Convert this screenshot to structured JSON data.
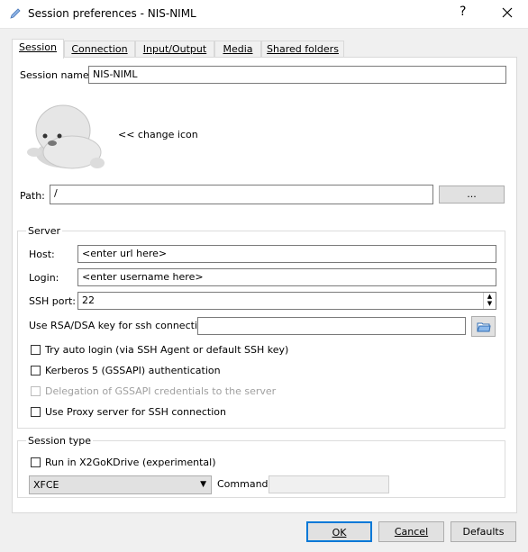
{
  "window": {
    "title": "Session preferences - NIS-NIML",
    "help_label": "?",
    "close_label": "✕"
  },
  "tabs": [
    {
      "label": "Session",
      "active": true
    },
    {
      "label": "Connection",
      "active": false
    },
    {
      "label": "Input/Output",
      "active": false
    },
    {
      "label": "Media",
      "active": false
    },
    {
      "label": "Shared folders",
      "active": false
    }
  ],
  "session": {
    "name_label": "Session name:",
    "name_value": "NIS-NIML",
    "change_icon_label": "<< change icon",
    "path_label": "Path:",
    "path_value": "/",
    "browse_label": "..."
  },
  "server": {
    "title": "Server",
    "host_label": "Host:",
    "host_placeholder": "<enter url here>",
    "login_label": "Login:",
    "login_placeholder": "<enter username here>",
    "ssh_port_label": "SSH port:",
    "ssh_port_value": "22",
    "rsa_label": "Use RSA/DSA key for ssh connection:",
    "rsa_value": "",
    "auto_login_label": "Try auto login (via SSH Agent or default SSH key)",
    "kerberos_label": "Kerberos 5 (GSSAPI) authentication",
    "delegation_label": "Delegation of GSSAPI credentials to the server",
    "proxy_label": "Use Proxy server for SSH connection"
  },
  "session_type": {
    "title": "Session type",
    "x2godrive_label": "Run in X2GoKDrive (experimental)",
    "type_value": "XFCE",
    "command_label": "Command:",
    "command_value": ""
  },
  "buttons": {
    "ok": "OK",
    "cancel": "Cancel",
    "defaults": "Defaults"
  }
}
